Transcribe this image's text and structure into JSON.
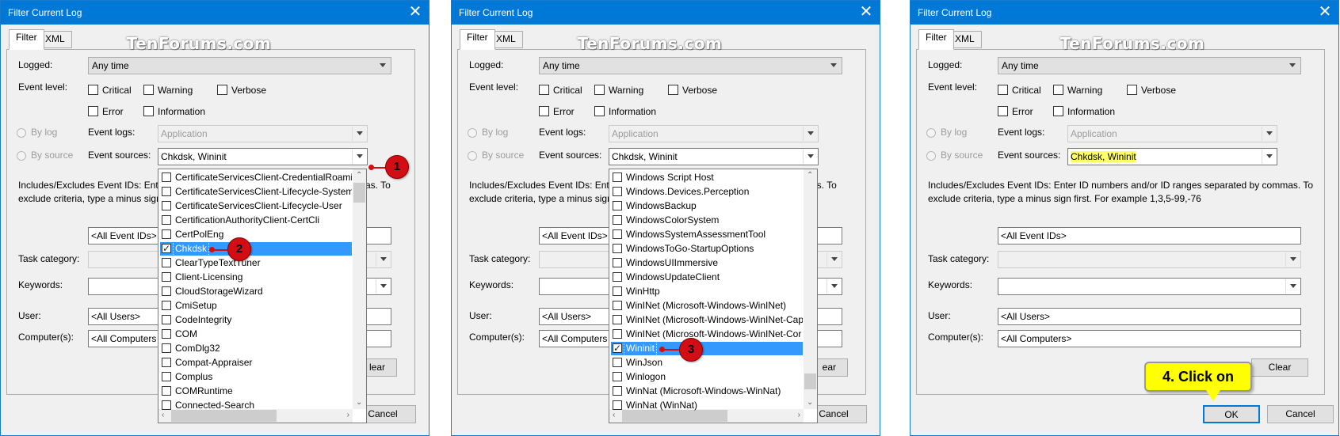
{
  "dialogs": [
    {
      "title": "Filter Current Log",
      "watermark": "TenForums.com",
      "tabs": [
        "Filter",
        "XML"
      ],
      "logged_label": "Logged:",
      "logged_value": "Any time",
      "event_level_label": "Event level:",
      "levels": {
        "critical": "Critical",
        "warning": "Warning",
        "verbose": "Verbose",
        "error": "Error",
        "information": "Information"
      },
      "by_log": "By log",
      "by_source": "By source",
      "event_logs_label": "Event logs:",
      "event_logs_value": "Application",
      "event_sources_label": "Event sources:",
      "event_sources_value": "Chkdsk, Wininit",
      "includes_line1": "Includes/Excludes Event IDs: Enter",
      "includes_line2": "exclude criteria, type a minus sign",
      "includes_tail1": "mas. To",
      "event_ids": "<All Event IDs>",
      "task_category_label": "Task category:",
      "keywords_label": "Keywords:",
      "user_label": "User:",
      "user_value": "<All Users>",
      "computers_label": "Computer(s):",
      "computers_value": "<All Computers",
      "clear_fragment": "lear",
      "cancel": "Cancel",
      "marker": "1",
      "sel_marker": "2",
      "list_items": [
        "CertificateServicesClient-CredentialRoamin",
        "CertificateServicesClient-Lifecycle-System",
        "CertificateServicesClient-Lifecycle-User",
        "CertificationAuthorityClient-CertCli",
        "CertPolEng",
        "Chkdsk",
        "ClearTypeTextTuner",
        "Client-Licensing",
        "CloudStorageWizard",
        "CmiSetup",
        "CodeIntegrity",
        "COM",
        "ComDlg32",
        "Compat-Appraiser",
        "Complus",
        "COMRuntime",
        "Connected-Search"
      ]
    },
    {
      "title": "Filter Current Log",
      "watermark": "TenForums.com",
      "tabs": [
        "Filter",
        "XML"
      ],
      "logged_label": "Logged:",
      "logged_value": "Any time",
      "event_level_label": "Event level:",
      "levels": {
        "critical": "Critical",
        "warning": "Warning",
        "verbose": "Verbose",
        "error": "Error",
        "information": "Information"
      },
      "by_log": "By log",
      "by_source": "By source",
      "event_logs_label": "Event logs:",
      "event_logs_value": "Application",
      "event_sources_label": "Event sources:",
      "event_sources_value": "Chkdsk, Wininit",
      "includes_line1": "Includes/Excludes Event IDs: Enter",
      "includes_line2": "exclude criteria, type a minus sign",
      "includes_tail1": "as. To",
      "event_ids": "<All Event IDs>",
      "task_category_label": "Task category:",
      "keywords_label": "Keywords:",
      "user_label": "User:",
      "user_value": "<All Users>",
      "computers_label": "Computer(s):",
      "computers_value": "<All Computers",
      "clear_fragment": "ear",
      "cancel": "Cancel",
      "sel_marker": "3",
      "list_items": [
        "Windows Script Host",
        "Windows.Devices.Perception",
        "WindowsBackup",
        "WindowsColorSystem",
        "WindowsSystemAssessmentTool",
        "WindowsToGo-StartupOptions",
        "WindowsUIImmersive",
        "WindowsUpdateClient",
        "WinHttp",
        "WinINet (Microsoft-Windows-WinINet)",
        "WinINet (Microsoft-Windows-WinINet-Cap",
        "WinINet (Microsoft-Windows-WinINet-Cor",
        "Wininit",
        "WinJson",
        "Winlogon",
        "WinNat (Microsoft-Windows-WinNat)",
        "WinNat (WinNat)"
      ]
    },
    {
      "title": "Filter Current Log",
      "watermark": "TenForums.com",
      "tabs": [
        "Filter",
        "XML"
      ],
      "logged_label": "Logged:",
      "logged_value": "Any time",
      "event_level_label": "Event level:",
      "levels": {
        "critical": "Critical",
        "warning": "Warning",
        "verbose": "Verbose",
        "error": "Error",
        "information": "Information"
      },
      "by_log": "By log",
      "by_source": "By source",
      "event_logs_label": "Event logs:",
      "event_logs_value": "Application",
      "event_sources_label": "Event sources:",
      "event_sources_value": "Chkdsk, Wininit",
      "includes_line1": "Includes/Excludes Event IDs: Enter ID numbers and/or ID ranges separated by commas. To",
      "includes_line2": "exclude criteria, type a minus sign first. For example 1,3,5-99,-76",
      "event_ids": "<All Event IDs>",
      "task_category_label": "Task category:",
      "keywords_label": "Keywords:",
      "user_label": "User:",
      "user_value": "<All Users>",
      "computers_label": "Computer(s):",
      "computers_value": "<All Computers>",
      "clear": "Clear",
      "ok": "OK",
      "cancel": "Cancel",
      "callout": "4. Click on"
    }
  ],
  "colors": {
    "titlebar": "#0078d7",
    "selection": "#3399ff",
    "marker": "#d20d13",
    "callout": "#ffff00",
    "highlight": "#ffff66"
  }
}
